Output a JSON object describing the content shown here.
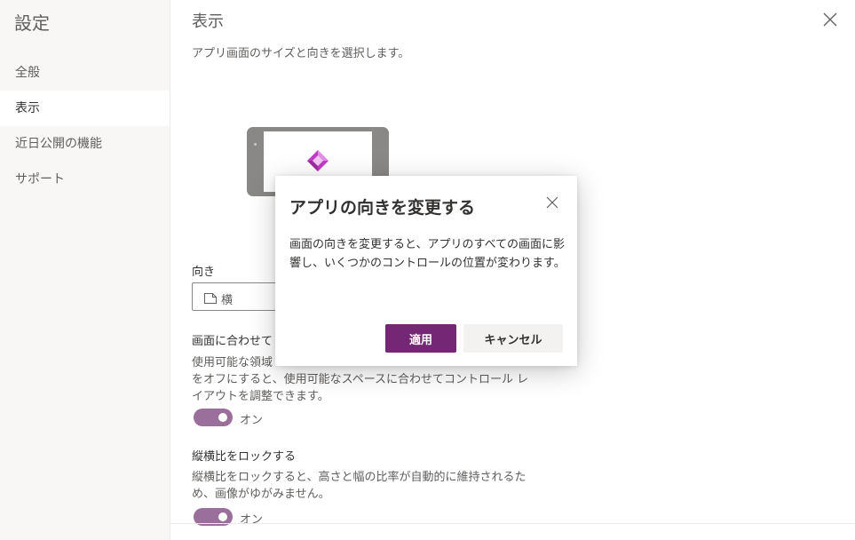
{
  "sidebar": {
    "title": "設定",
    "items": [
      {
        "label": "全般"
      },
      {
        "label": "表示"
      },
      {
        "label": "近日公開の機能"
      },
      {
        "label": "サポート"
      }
    ]
  },
  "main": {
    "title": "表示",
    "description": "アプリ画面のサイズと向きを選択します。",
    "orientation": {
      "label": "向き",
      "value": "横"
    },
    "scale_to_fit": {
      "title": "画面に合わせて",
      "desc": "使用可能な領域",
      "desc_line2": "をオフにすると、使用可能なスペースに合わせてコントロール レイアウトを調整できます。",
      "toggle_label": "オン"
    },
    "lock_aspect": {
      "title": "縦横比をロックする",
      "desc": "縦横比をロックすると、高さと幅の比率が自動的に維持されるため、画像がゆがみません。",
      "toggle_label": "オン"
    }
  },
  "dialog": {
    "title": "アプリの向きを変更する",
    "body": "画面の向きを変更すると、アプリのすべての画面に影響し、いくつかのコントロールの位置が変わります。",
    "apply_label": "適用",
    "cancel_label": "キャンセル"
  },
  "colors": {
    "accent": "#742774",
    "toggle_on": "#9b6f9b",
    "sidebar_bg": "#f8f7f6"
  }
}
